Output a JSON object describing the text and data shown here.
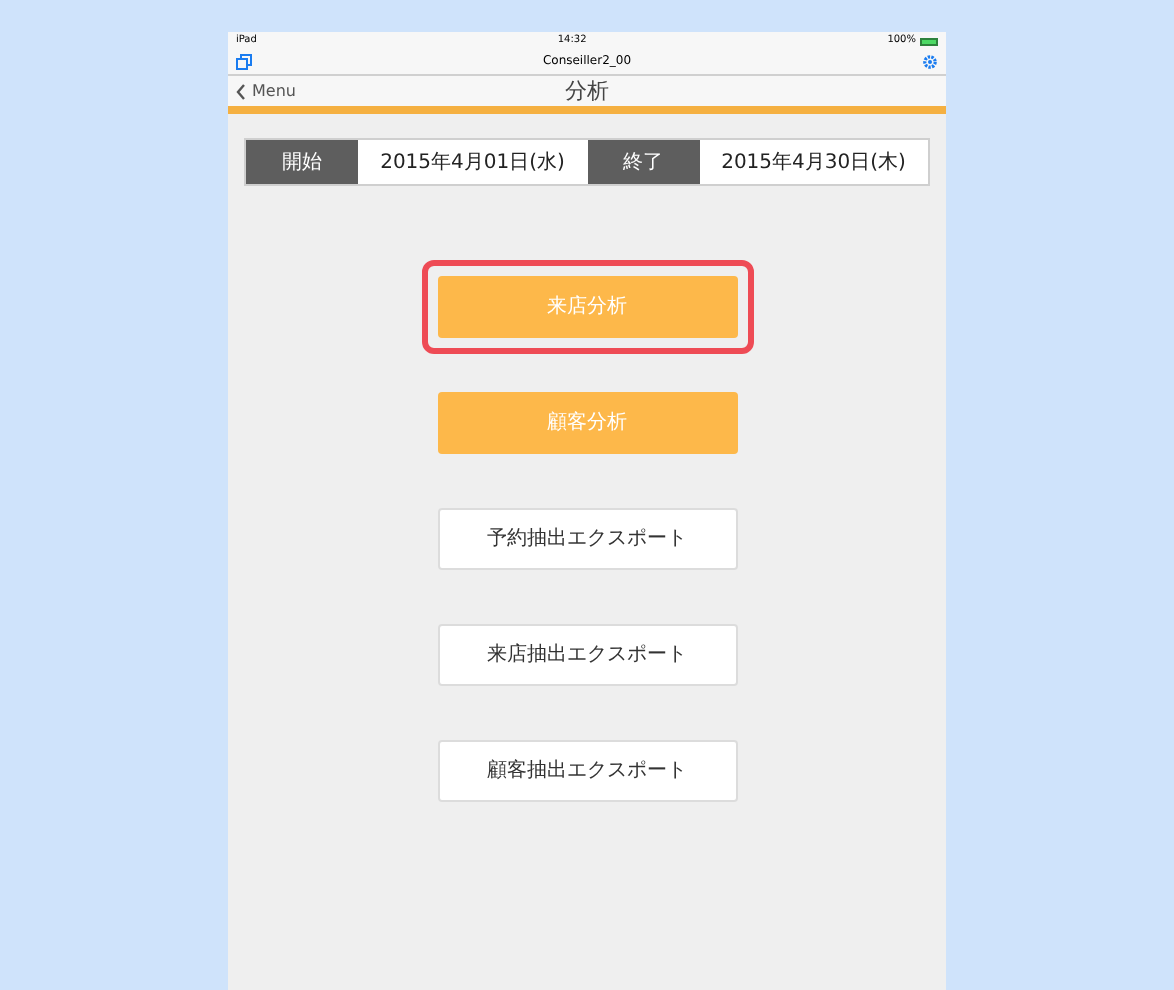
{
  "status_bar": {
    "carrier": "iPad",
    "time": "14:32",
    "battery": "100%"
  },
  "toolbar": {
    "title": "Conseiller2_00"
  },
  "nav": {
    "back": "Menu",
    "title": "分析"
  },
  "period": {
    "start_label": "開始",
    "start": "2015年4月01日(水)",
    "end_label": "終了",
    "end": "2015年4月30日(木)"
  },
  "buttons": [
    {
      "label": "来店分析",
      "kind": "primary",
      "highlighted": true
    },
    {
      "label": "顧客分析",
      "kind": "primary",
      "highlighted": false
    },
    {
      "label": "予約抽出エクスポート",
      "kind": "secondary",
      "highlighted": false
    },
    {
      "label": "来店抽出エクスポート",
      "kind": "secondary",
      "highlighted": false
    },
    {
      "label": "顧客抽出エクスポート",
      "kind": "secondary",
      "highlighted": false
    }
  ]
}
